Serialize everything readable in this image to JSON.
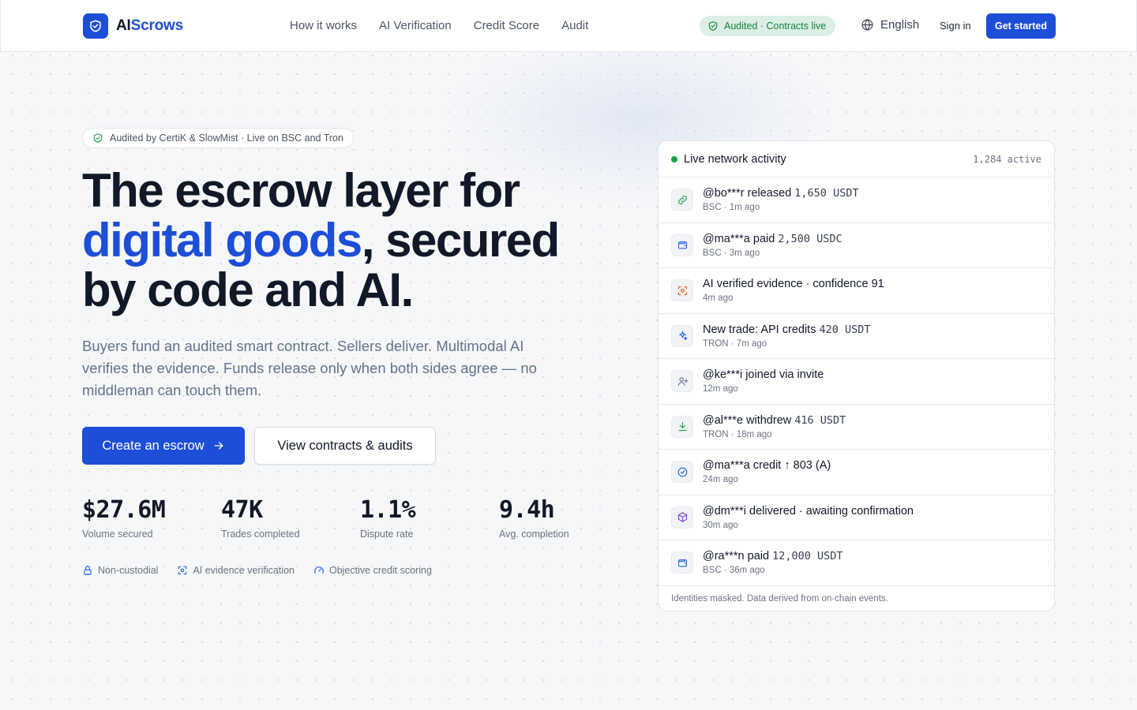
{
  "brand": {
    "name_ai": "AI",
    "name_rest": "Scrows"
  },
  "nav": [
    {
      "label": "How it works"
    },
    {
      "label": "AI Verification"
    },
    {
      "label": "Credit Score"
    },
    {
      "label": "Audit"
    }
  ],
  "header": {
    "audit_pill": "Audited · Contracts live",
    "language": "English",
    "sign_in": "Sign in",
    "get_started": "Get started"
  },
  "hero": {
    "trust_pill": "Audited by CertiK & SlowMist · Live on BSC and Tron",
    "title_line1": "The escrow layer for",
    "title_accent": "digital goods",
    "title_after_accent": ", secured",
    "title_line3": "by code and AI.",
    "subtitle": "Buyers fund an audited smart contract. Sellers deliver. Multimodal AI verifies the evidence. Funds release only when both sides agree — no middleman can touch them.",
    "cta_primary": "Create an escrow",
    "cta_secondary": "View contracts & audits"
  },
  "stats": [
    {
      "value": "$27.6M",
      "label": "Volume secured"
    },
    {
      "value": "47K",
      "label": "Trades completed"
    },
    {
      "value": "1.1%",
      "label": "Dispute rate"
    },
    {
      "value": "9.4h",
      "label": "Avg. completion"
    }
  ],
  "features": [
    {
      "label": "Non-custodial",
      "icon": "lock-icon"
    },
    {
      "label": "AI evidence verification",
      "icon": "scan-icon"
    },
    {
      "label": "Objective credit scoring",
      "icon": "gauge-icon"
    }
  ],
  "activity": {
    "title": "Live network activity",
    "count": "1,284 active",
    "footer": "Identities masked. Data derived from on-chain events.",
    "rows": [
      {
        "icon": "link-icon",
        "text": "@bo***r released",
        "amount": "1,650 USDT",
        "meta": "BSC  ·  1m ago",
        "color": "#16a34a"
      },
      {
        "icon": "wallet-icon",
        "text": "@ma***a paid",
        "amount": "2,500 USDC",
        "meta": "BSC  ·  3m ago",
        "color": "#2563eb"
      },
      {
        "icon": "ai-scan-icon",
        "text": "AI verified evidence · confidence 91",
        "amount": "",
        "meta": "4m ago",
        "color": "#ea580c"
      },
      {
        "icon": "sparkle-icon",
        "text": "New trade: API credits",
        "amount": "420 USDT",
        "meta": "TRON  ·  7m ago",
        "color": "#2563eb"
      },
      {
        "icon": "user-plus-icon",
        "text": "@ke***i joined via invite",
        "amount": "",
        "meta": "12m ago",
        "color": "#64748b"
      },
      {
        "icon": "download-icon",
        "text": "@al***e withdrew",
        "amount": "416 USDT",
        "meta": "TRON  ·  18m ago",
        "color": "#16a34a"
      },
      {
        "icon": "check-circle-icon",
        "text": "@ma***a credit ↑ 803 (A)",
        "amount": "",
        "meta": "24m ago",
        "color": "#2563eb"
      },
      {
        "icon": "package-icon",
        "text": "@dm***i delivered · awaiting confirmation",
        "amount": "",
        "meta": "30m ago",
        "color": "#7c3aed"
      },
      {
        "icon": "wallet-icon",
        "text": "@ra***n paid",
        "amount": "12,000 USDT",
        "meta": "BSC  ·  36m ago",
        "color": "#2563eb"
      }
    ]
  },
  "colors": {
    "brand": "#1d4ed8",
    "live": "#16a34a",
    "audit_pill_bg": "#dcefe4",
    "audit_pill_text": "#15803d"
  }
}
